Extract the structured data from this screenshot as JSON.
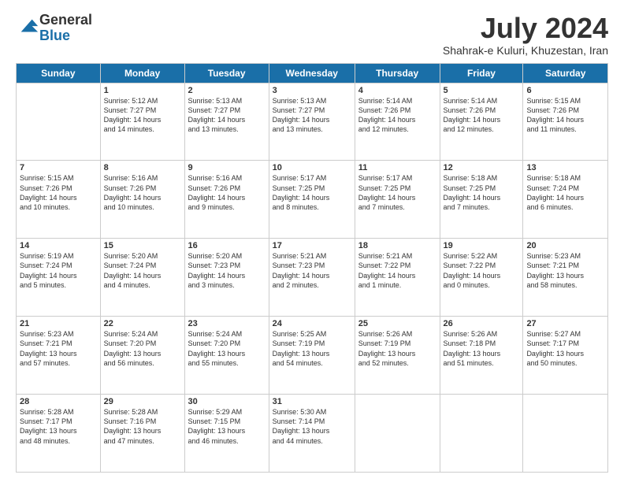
{
  "logo": {
    "general": "General",
    "blue": "Blue"
  },
  "header": {
    "month": "July 2024",
    "location": "Shahrak-e Kuluri, Khuzestan, Iran"
  },
  "days_of_week": [
    "Sunday",
    "Monday",
    "Tuesday",
    "Wednesday",
    "Thursday",
    "Friday",
    "Saturday"
  ],
  "weeks": [
    [
      {
        "day": "",
        "info": ""
      },
      {
        "day": "1",
        "info": "Sunrise: 5:12 AM\nSunset: 7:27 PM\nDaylight: 14 hours\nand 14 minutes."
      },
      {
        "day": "2",
        "info": "Sunrise: 5:13 AM\nSunset: 7:27 PM\nDaylight: 14 hours\nand 13 minutes."
      },
      {
        "day": "3",
        "info": "Sunrise: 5:13 AM\nSunset: 7:27 PM\nDaylight: 14 hours\nand 13 minutes."
      },
      {
        "day": "4",
        "info": "Sunrise: 5:14 AM\nSunset: 7:26 PM\nDaylight: 14 hours\nand 12 minutes."
      },
      {
        "day": "5",
        "info": "Sunrise: 5:14 AM\nSunset: 7:26 PM\nDaylight: 14 hours\nand 12 minutes."
      },
      {
        "day": "6",
        "info": "Sunrise: 5:15 AM\nSunset: 7:26 PM\nDaylight: 14 hours\nand 11 minutes."
      }
    ],
    [
      {
        "day": "7",
        "info": "Sunrise: 5:15 AM\nSunset: 7:26 PM\nDaylight: 14 hours\nand 10 minutes."
      },
      {
        "day": "8",
        "info": "Sunrise: 5:16 AM\nSunset: 7:26 PM\nDaylight: 14 hours\nand 10 minutes."
      },
      {
        "day": "9",
        "info": "Sunrise: 5:16 AM\nSunset: 7:26 PM\nDaylight: 14 hours\nand 9 minutes."
      },
      {
        "day": "10",
        "info": "Sunrise: 5:17 AM\nSunset: 7:25 PM\nDaylight: 14 hours\nand 8 minutes."
      },
      {
        "day": "11",
        "info": "Sunrise: 5:17 AM\nSunset: 7:25 PM\nDaylight: 14 hours\nand 7 minutes."
      },
      {
        "day": "12",
        "info": "Sunrise: 5:18 AM\nSunset: 7:25 PM\nDaylight: 14 hours\nand 7 minutes."
      },
      {
        "day": "13",
        "info": "Sunrise: 5:18 AM\nSunset: 7:24 PM\nDaylight: 14 hours\nand 6 minutes."
      }
    ],
    [
      {
        "day": "14",
        "info": "Sunrise: 5:19 AM\nSunset: 7:24 PM\nDaylight: 14 hours\nand 5 minutes."
      },
      {
        "day": "15",
        "info": "Sunrise: 5:20 AM\nSunset: 7:24 PM\nDaylight: 14 hours\nand 4 minutes."
      },
      {
        "day": "16",
        "info": "Sunrise: 5:20 AM\nSunset: 7:23 PM\nDaylight: 14 hours\nand 3 minutes."
      },
      {
        "day": "17",
        "info": "Sunrise: 5:21 AM\nSunset: 7:23 PM\nDaylight: 14 hours\nand 2 minutes."
      },
      {
        "day": "18",
        "info": "Sunrise: 5:21 AM\nSunset: 7:22 PM\nDaylight: 14 hours\nand 1 minute."
      },
      {
        "day": "19",
        "info": "Sunrise: 5:22 AM\nSunset: 7:22 PM\nDaylight: 14 hours\nand 0 minutes."
      },
      {
        "day": "20",
        "info": "Sunrise: 5:23 AM\nSunset: 7:21 PM\nDaylight: 13 hours\nand 58 minutes."
      }
    ],
    [
      {
        "day": "21",
        "info": "Sunrise: 5:23 AM\nSunset: 7:21 PM\nDaylight: 13 hours\nand 57 minutes."
      },
      {
        "day": "22",
        "info": "Sunrise: 5:24 AM\nSunset: 7:20 PM\nDaylight: 13 hours\nand 56 minutes."
      },
      {
        "day": "23",
        "info": "Sunrise: 5:24 AM\nSunset: 7:20 PM\nDaylight: 13 hours\nand 55 minutes."
      },
      {
        "day": "24",
        "info": "Sunrise: 5:25 AM\nSunset: 7:19 PM\nDaylight: 13 hours\nand 54 minutes."
      },
      {
        "day": "25",
        "info": "Sunrise: 5:26 AM\nSunset: 7:19 PM\nDaylight: 13 hours\nand 52 minutes."
      },
      {
        "day": "26",
        "info": "Sunrise: 5:26 AM\nSunset: 7:18 PM\nDaylight: 13 hours\nand 51 minutes."
      },
      {
        "day": "27",
        "info": "Sunrise: 5:27 AM\nSunset: 7:17 PM\nDaylight: 13 hours\nand 50 minutes."
      }
    ],
    [
      {
        "day": "28",
        "info": "Sunrise: 5:28 AM\nSunset: 7:17 PM\nDaylight: 13 hours\nand 48 minutes."
      },
      {
        "day": "29",
        "info": "Sunrise: 5:28 AM\nSunset: 7:16 PM\nDaylight: 13 hours\nand 47 minutes."
      },
      {
        "day": "30",
        "info": "Sunrise: 5:29 AM\nSunset: 7:15 PM\nDaylight: 13 hours\nand 46 minutes."
      },
      {
        "day": "31",
        "info": "Sunrise: 5:30 AM\nSunset: 7:14 PM\nDaylight: 13 hours\nand 44 minutes."
      },
      {
        "day": "",
        "info": ""
      },
      {
        "day": "",
        "info": ""
      },
      {
        "day": "",
        "info": ""
      }
    ]
  ]
}
